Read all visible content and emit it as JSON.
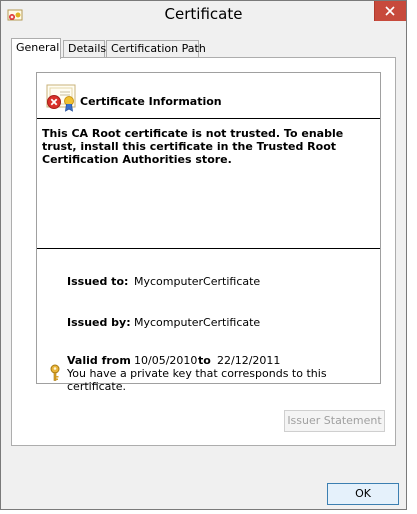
{
  "window": {
    "title": "Certificate",
    "accent_close": "#c74a3c"
  },
  "tabs": [
    {
      "label": "General",
      "active": true
    },
    {
      "label": "Details",
      "active": false
    },
    {
      "label": "Certification Path",
      "active": false
    }
  ],
  "info": {
    "heading": "Certificate Information",
    "warning": "This CA Root certificate is not trusted. To enable trust, install this certificate in the Trusted Root Certification Authorities store.",
    "issued_to_label": "Issued to:",
    "issued_to_value": "MycomputerCertificate",
    "issued_by_label": "Issued by:",
    "issued_by_value": "MycomputerCertificate",
    "valid_from_label": "Valid from",
    "valid_from_value": "10/05/2010",
    "valid_to_label": "to",
    "valid_to_value": "22/12/2011",
    "private_key_text": "You have a private key that corresponds to this certificate."
  },
  "buttons": {
    "issuer_statement": "Issuer Statement",
    "ok": "OK"
  },
  "icons": {
    "app": "certificate-app-icon",
    "close": "close-icon",
    "cert": "certificate-error-icon",
    "key": "key-icon"
  }
}
